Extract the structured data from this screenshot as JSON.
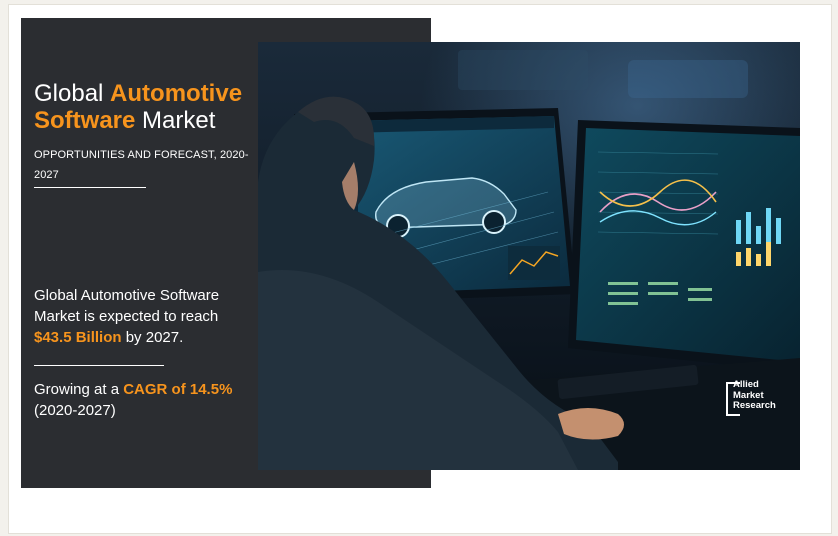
{
  "headline": {
    "part1": "Global ",
    "highlight": "Automotive Software",
    "part2": " Market"
  },
  "subtitle": "OPPORTUNITIES AND FORECAST, 2020-2027",
  "stat_market": {
    "text1": "Global Automotive Software Market is expected to reach ",
    "value": "$43.5 Billion",
    "text2": " by 2027."
  },
  "stat_cagr": {
    "text1": "Growing at a ",
    "value": "CAGR of 14.5%",
    "text2": " (2020-2027)"
  },
  "logo": {
    "line1": "Allied",
    "line2": "Market",
    "line3": "Research"
  },
  "colors": {
    "accent": "#f7941d",
    "panel": "#2b2d31"
  }
}
